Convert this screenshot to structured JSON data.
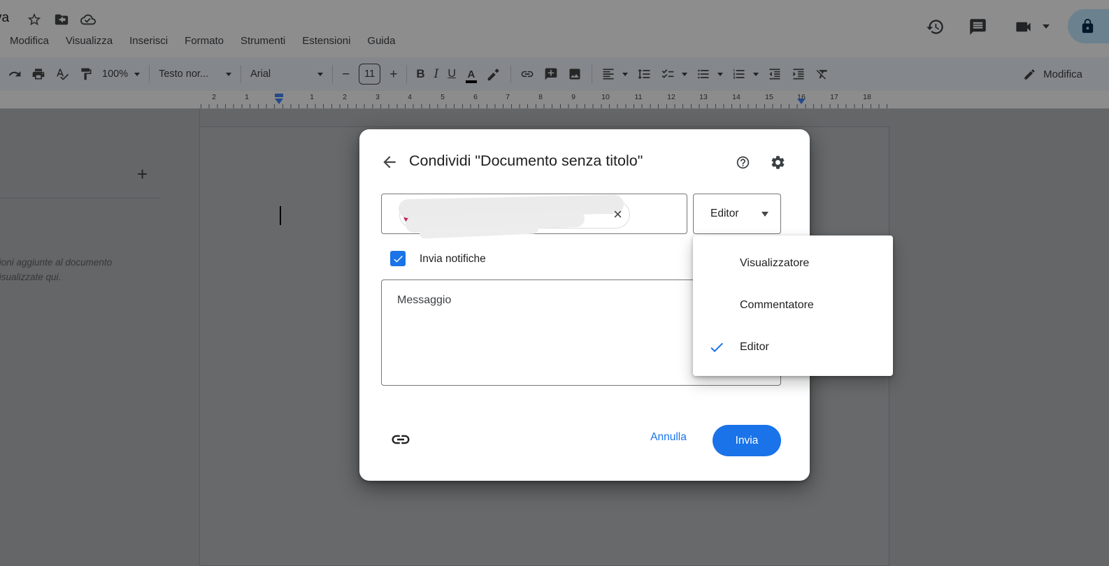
{
  "header": {
    "title_fragment": "va",
    "menu_items": [
      "Modifica",
      "Visualizza",
      "Inserisci",
      "Formato",
      "Strumenti",
      "Estensioni",
      "Guida"
    ],
    "icons": {
      "star-icon": "star outline",
      "move-to-folder-icon": "folder with arrow",
      "cloud-saved-icon": "cloud with check",
      "version-history-icon": "clock with arrow",
      "comments-icon": "speech bubble",
      "join-call-icon": "video camera",
      "share-lock-icon": "padlock"
    }
  },
  "toolbar": {
    "zoom": "100%",
    "paragraph_style": "Testo nor...",
    "font": "Arial",
    "font_size": "11",
    "bold": "B",
    "italic": "I",
    "underline": "U",
    "text_color": "A",
    "minus": "−",
    "plus": "+",
    "mode_label": "Modifica"
  },
  "ruler": {
    "numbers": [
      "2",
      "1",
      "1",
      "2",
      "3",
      "4",
      "5",
      "6",
      "7",
      "8",
      "9",
      "10",
      "11",
      "12",
      "13",
      "14",
      "15",
      "16",
      "17",
      "18"
    ]
  },
  "outline_panel": {
    "add_summary_glyph": "+",
    "hint_line1": "zioni aggiunte al documento",
    "hint_line2": "visualizzate qui."
  },
  "share_dialog": {
    "title": "Condividi \"Documento senza titolo\"",
    "chip_close_glyph": "×",
    "role_selector_value": "Editor",
    "notify_checkbox_label": "Invia notifiche",
    "notify_checked": true,
    "message_placeholder": "Messaggio",
    "cancel_label": "Annulla",
    "send_label": "Invia"
  },
  "role_menu": {
    "items": [
      "Visualizzatore",
      "Commentatore",
      "Editor"
    ],
    "selected": "Editor"
  },
  "colors": {
    "accent_blue": "#1a73e8",
    "chip_avatar": "#c2275c",
    "share_pill": "#c2e7ff",
    "toolbar_bg": "#edf2fa"
  }
}
